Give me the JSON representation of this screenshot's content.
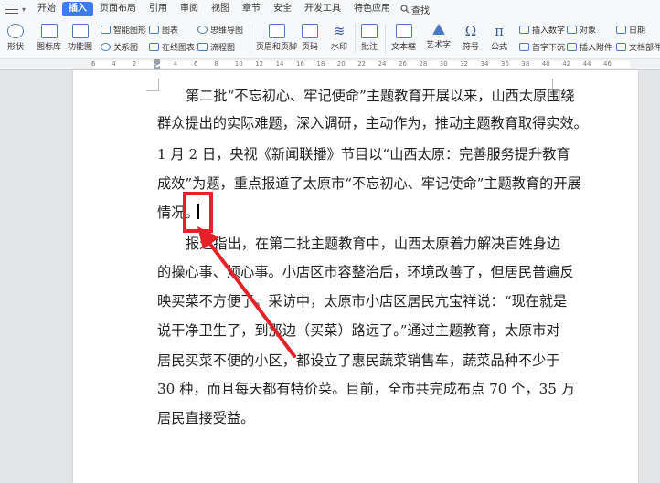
{
  "menubar": {
    "items": [
      "开始",
      "插入",
      "页面布局",
      "引用",
      "审阅",
      "视图",
      "章节",
      "安全",
      "开发工具",
      "特色应用"
    ],
    "active_index": 1,
    "search_label": "查找"
  },
  "ribbon": {
    "shapes": "形状",
    "icon_lib": "图标库",
    "function_chart": "功能图",
    "smart_graphic": "智能图形",
    "relation_chart": "关系图",
    "chart": "图表",
    "online_chart": "在线图表",
    "mind_map": "思维导图",
    "flowchart": "流程图",
    "header_footer": "页眉和页脚",
    "page_number": "页码",
    "watermark": "水印",
    "comment": "批注",
    "textbox": "文本框",
    "wordart": "艺术字",
    "symbol": "符号",
    "formula": "公式",
    "insert_number": "插入数字",
    "object": "对象",
    "date": "日期",
    "dropcap": "首字下沉",
    "attachment": "插入附件",
    "doc_parts": "文档部件"
  },
  "ruler": {
    "marks": [
      "6",
      "4",
      "2",
      "2",
      "4",
      "6",
      "8",
      "10",
      "12",
      "14",
      "16",
      "18",
      "20",
      "22",
      "24",
      "26",
      "28",
      "30",
      "32",
      "34",
      "36",
      "38",
      "40",
      "42",
      "44",
      "46"
    ]
  },
  "document": {
    "lines": [
      "第二批“不忘初心、牢记使命”主题教育开展以来，山西太原围绕",
      "群众提出的实际难题，深入调研，主动作为，推动主题教育取得实效。",
      "1 月 2 日，央视《新闻联播》节目以“山西太原：完善服务提升教育",
      "成效”为题，重点报道了太原市“不忘初心、牢记使命”主题教育的开展",
      "情况。",
      "报道指出，在第二批主题教育中，山西太原着力解决百姓身边",
      "的操心事、烦心事。小店区市容整治后，环境改善了，但居民普遍反",
      "映买菜不方便了。采访中，太原市小店区居民亢宝祥说：“现在就是",
      "说干净卫生了，到那边（买菜）路远了。”通过主题教育，太原市对",
      "居民买菜不便的小区，都设立了惠民蔬菜销售车，蔬菜品种不少于",
      "30 种，而且每天都有特价菜。目前，全市共完成布点 70 个，35 万",
      "居民直接受益。"
    ]
  },
  "annotation": {
    "color": "#e5212a"
  }
}
